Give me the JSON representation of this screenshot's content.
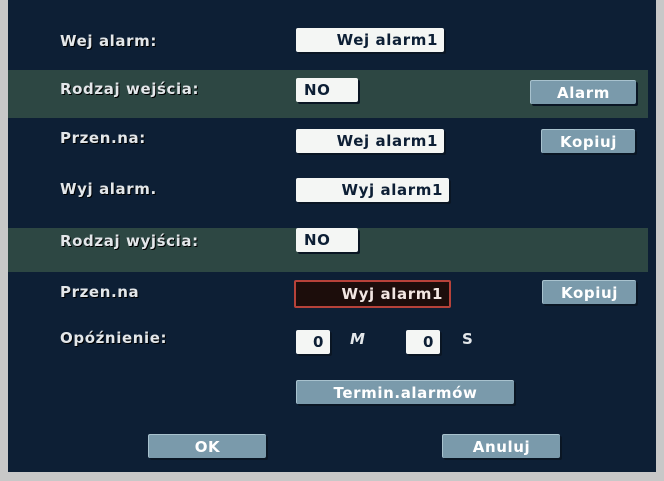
{
  "rows": {
    "alarm_input": {
      "label": "Wej alarm:",
      "value": "Wej alarm1"
    },
    "input_type": {
      "label": "Rodzaj wejścia:",
      "value": "NO",
      "button": "Alarm"
    },
    "input_copy": {
      "label": "Przen.na:",
      "value": "Wej alarm1",
      "button": "Kopiuj"
    },
    "alarm_output": {
      "label": "Wyj alarm.",
      "value": "Wyj alarm1"
    },
    "output_type": {
      "label": "Rodzaj wyjścia:",
      "value": "NO"
    },
    "output_copy": {
      "label": "Przen.na",
      "value": "Wyj alarm1",
      "button": "Kopiuj"
    },
    "delay": {
      "label": "Opóźnienie:",
      "minutes": "0",
      "minutes_unit": "M",
      "seconds": "0",
      "seconds_unit": "S"
    }
  },
  "schedule_button": "Termin.alarmów",
  "footer": {
    "ok": "OK",
    "cancel": "Anuluj"
  },
  "colors": {
    "background": "#0d1f35",
    "band": "#2d4743",
    "button": "#7a9aab",
    "field": "#f4f6f4",
    "selected_border": "#b6423a"
  }
}
